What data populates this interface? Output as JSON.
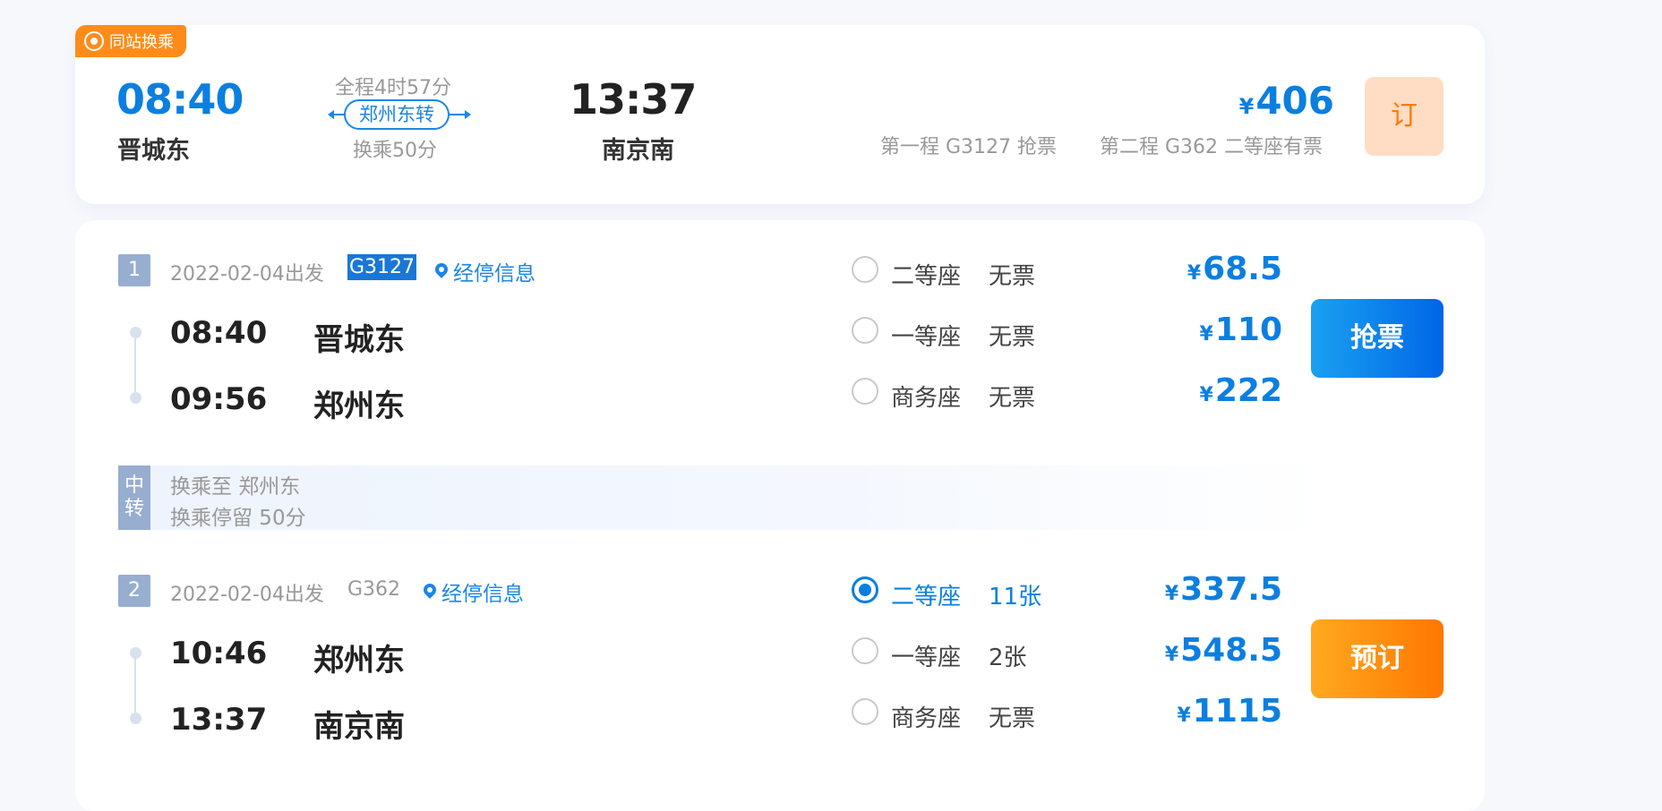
{
  "summary": {
    "tag": "同站换乘",
    "depart_time": "08:40",
    "depart_station": "晋城东",
    "duration": "全程4时57分",
    "transfer_station": "郑州东转",
    "transfer_wait": "换乘50分",
    "arrive_time": "13:37",
    "arrive_station": "南京南",
    "currency": "¥",
    "total_price": "406",
    "leg1_status": "第一程 G3127 抢票",
    "leg2_status": "第二程 G362 二等座有票",
    "book_label": "订"
  },
  "legs": [
    {
      "index": "1",
      "date": "2022-02-04出发",
      "train_no": "G3127",
      "stops_link": "经停信息",
      "from_time": "08:40",
      "from_station": "晋城东",
      "to_time": "09:56",
      "to_station": "郑州东",
      "seats": [
        {
          "name": "二等座",
          "avail": "无票",
          "price": "68.5",
          "checked": false
        },
        {
          "name": "一等座",
          "avail": "无票",
          "price": "110",
          "checked": false
        },
        {
          "name": "商务座",
          "avail": "无票",
          "price": "222",
          "checked": false
        }
      ],
      "action": "抢票"
    },
    {
      "index": "2",
      "date": "2022-02-04出发",
      "train_no": "G362",
      "stops_link": "经停信息",
      "from_time": "10:46",
      "from_station": "郑州东",
      "to_time": "13:37",
      "to_station": "南京南",
      "seats": [
        {
          "name": "二等座",
          "avail": "11张",
          "price": "337.5",
          "checked": true
        },
        {
          "name": "一等座",
          "avail": "2张",
          "price": "548.5",
          "checked": false
        },
        {
          "name": "商务座",
          "avail": "无票",
          "price": "1115",
          "checked": false
        }
      ],
      "action": "预订"
    }
  ],
  "transfer": {
    "badge_line1": "中",
    "badge_line2": "转",
    "to": "换乘至 郑州东",
    "stay": "换乘停留 50分"
  },
  "colors": {
    "accent": "#0b7fe0",
    "orange": "#ff8c1a",
    "index_badge": "#98aed0"
  },
  "icons": {
    "tag": "transfer-icon",
    "stops": "location-pin-icon"
  }
}
